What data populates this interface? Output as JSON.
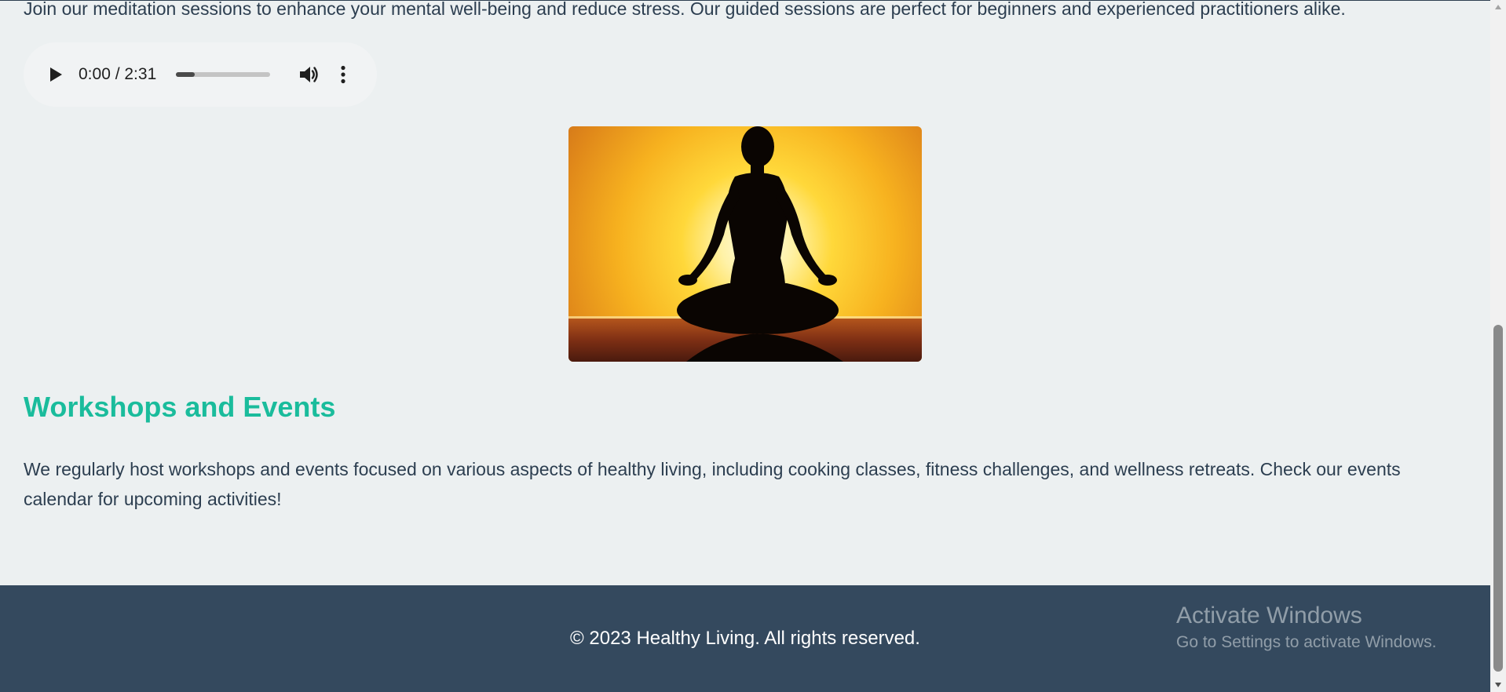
{
  "meditation": {
    "intro": "Join our meditation sessions to enhance your mental well-being and reduce stress. Our guided sessions are perfect for beginners and experienced practitioners alike.",
    "audio": {
      "time": "0:00 / 2:31",
      "progress": 0.2
    },
    "image_icon": "meditation-silhouette-sunset"
  },
  "workshops": {
    "heading": "Workshops and Events",
    "text": "We regularly host workshops and events focused on various aspects of healthy living, including cooking classes, fitness challenges, and wellness retreats. Check our events calendar for upcoming activities!"
  },
  "footer": {
    "copyright": "© 2023 Healthy Living. All rights reserved."
  },
  "watermark": {
    "title": "Activate Windows",
    "subtitle": "Go to Settings to activate Windows."
  },
  "colors": {
    "page_background": "#ecf0f1",
    "text": "#2c3e50",
    "heading_accent": "#1abc9c",
    "footer_background": "#34495e"
  }
}
